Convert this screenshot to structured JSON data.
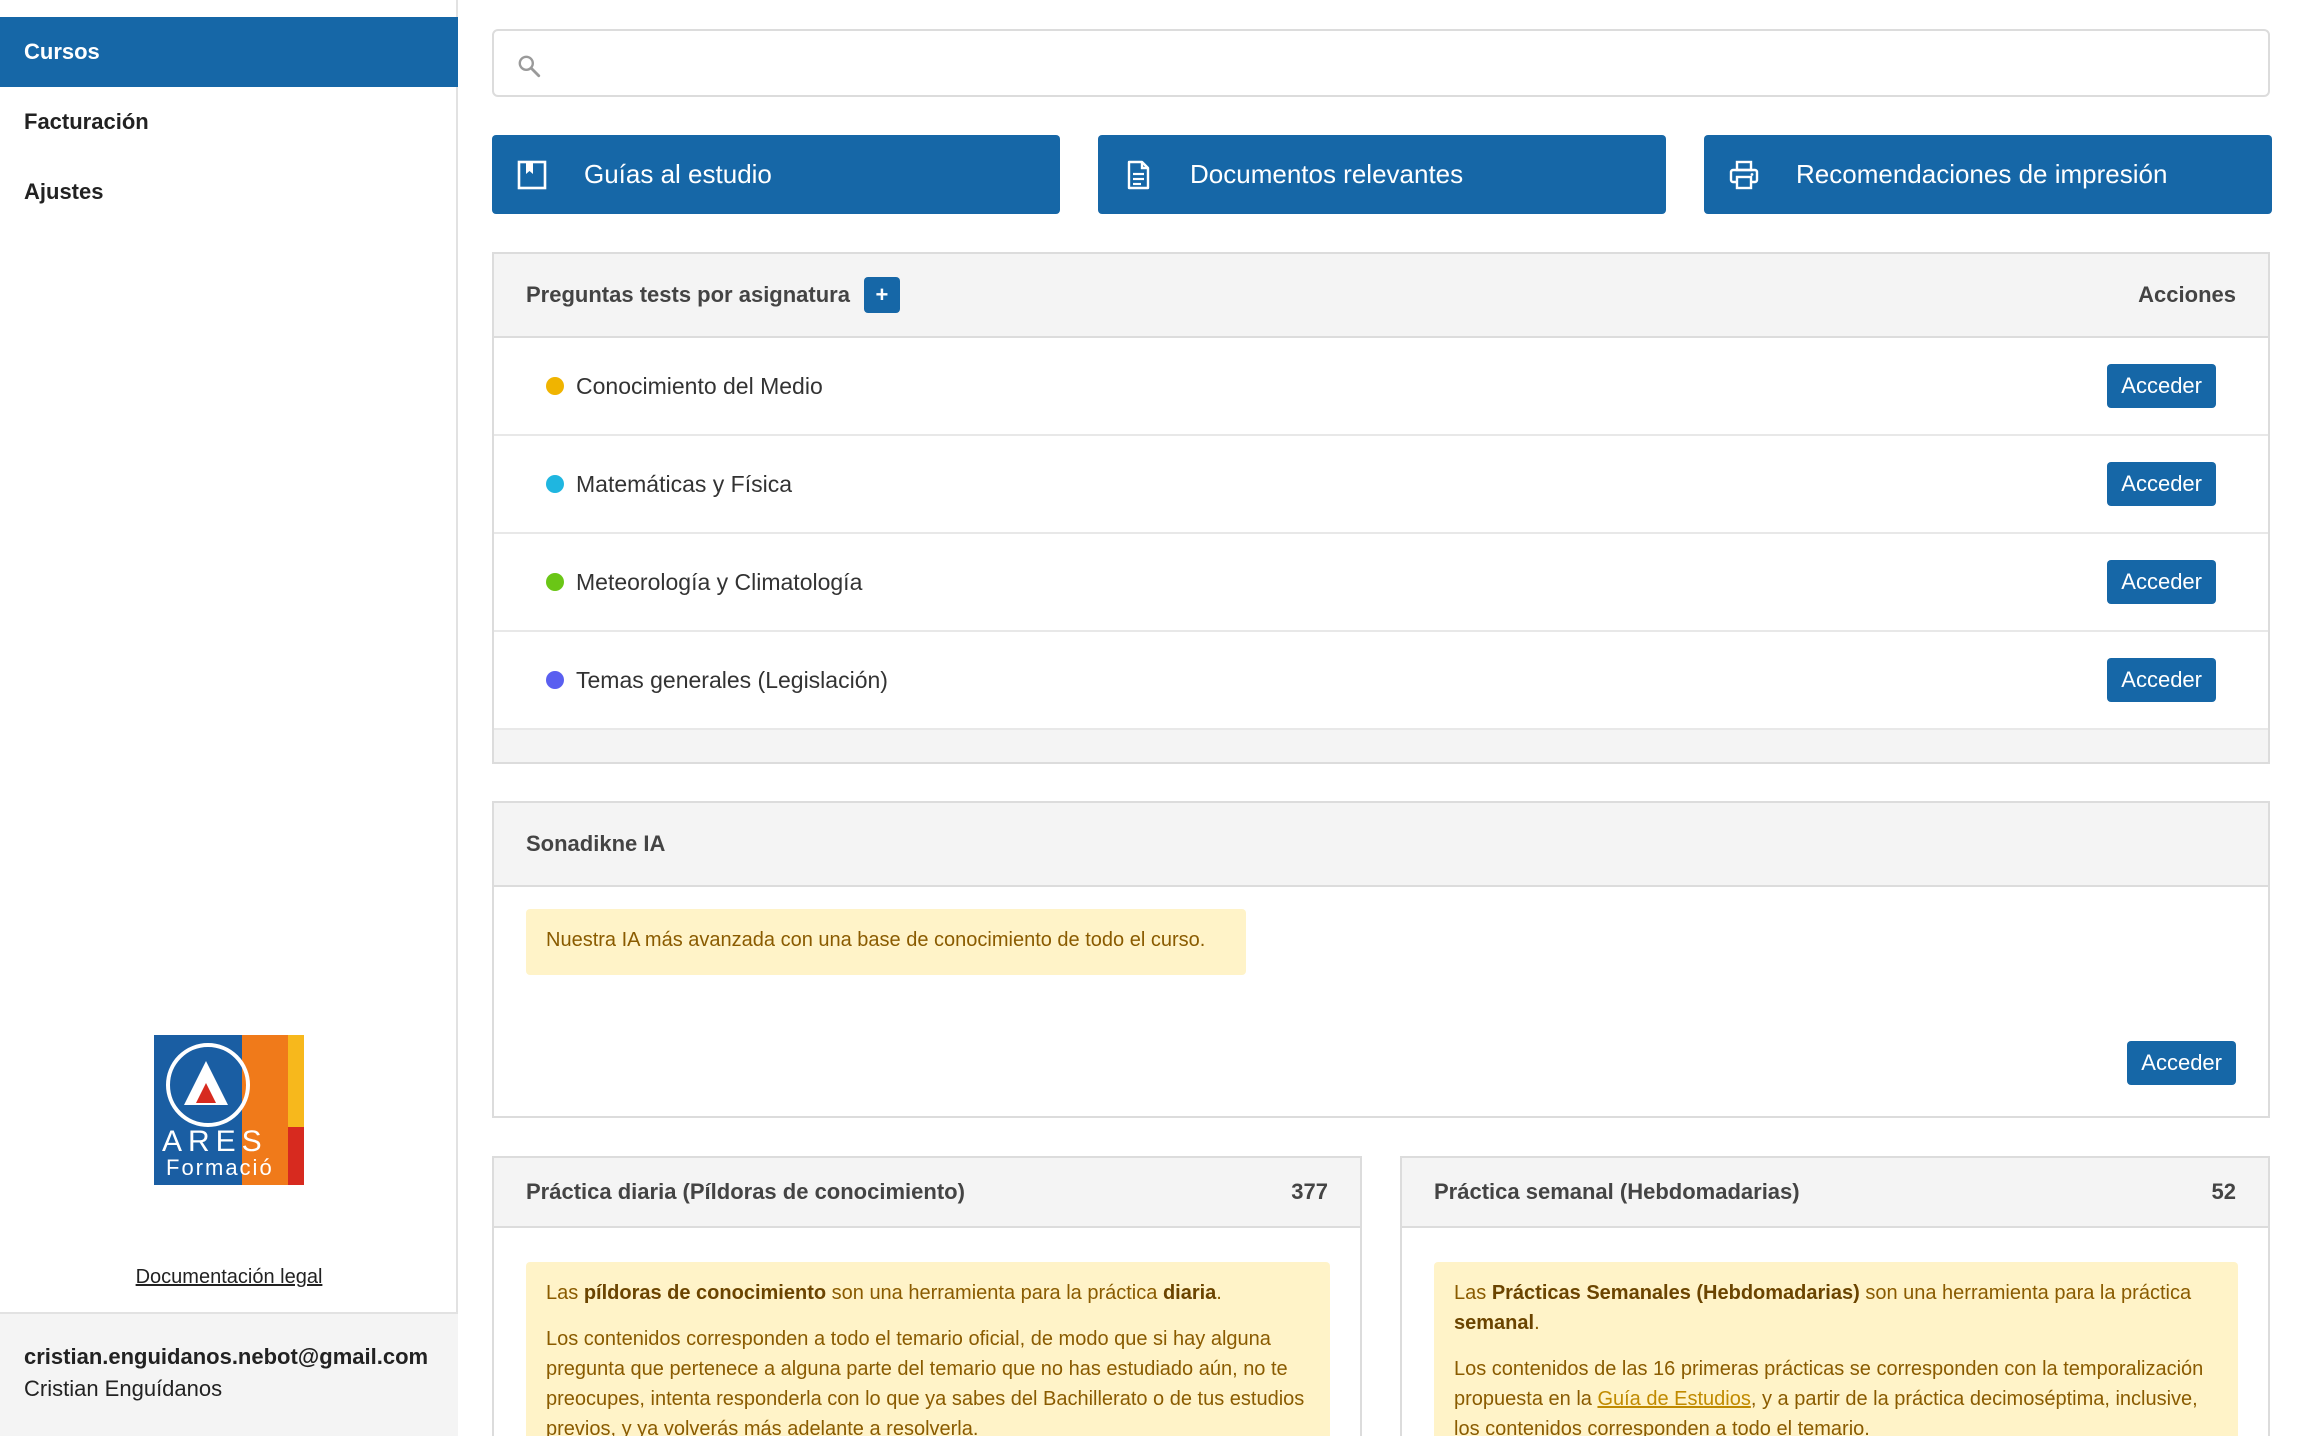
{
  "sidebar": {
    "items": [
      {
        "label": "Cursos",
        "active": true
      },
      {
        "label": "Facturación",
        "active": false
      },
      {
        "label": "Ajustes",
        "active": false
      }
    ],
    "logo": {
      "word": "ARES",
      "sub": "Formació"
    },
    "legal_link": "Documentación legal",
    "user": {
      "email": "cristian.enguidanos.nebot@gmail.com",
      "name": "Cristian Enguídanos"
    }
  },
  "search": {
    "placeholder": "",
    "value": ""
  },
  "quick_buttons": [
    {
      "label": "Guías al estudio",
      "icon": "book-icon"
    },
    {
      "label": "Documentos relevantes",
      "icon": "document-icon"
    },
    {
      "label": "Recomendaciones de impresión",
      "icon": "printer-icon"
    }
  ],
  "tests_card": {
    "title": "Preguntas tests por asignatura",
    "add_label": "+",
    "actions_label": "Acciones",
    "subjects": [
      {
        "name": "Conocimiento del Medio",
        "color": "#f0b400",
        "action": "Acceder"
      },
      {
        "name": "Matemáticas y Física",
        "color": "#1fb6e0",
        "action": "Acceder"
      },
      {
        "name": "Meteorología y Climatología",
        "color": "#6ac616",
        "action": "Acceder"
      },
      {
        "name": "Temas generales (Legislación)",
        "color": "#5a5ff0",
        "action": "Acceder"
      }
    ]
  },
  "ia_card": {
    "title": "Sonadikne IA",
    "info": "Nuestra IA más avanzada con una base de conocimiento de todo el curso.",
    "action": "Acceder"
  },
  "daily_card": {
    "title": "Práctica diaria (Píldoras de conocimiento)",
    "count": "377",
    "p1_a": "Las ",
    "p1_b": "píldoras de conocimiento",
    "p1_c": " son una herramienta para la práctica ",
    "p1_d": "diaria",
    "p1_e": ".",
    "p2": "Los contenidos corresponden a todo el temario oficial, de modo que si hay alguna pregunta que pertenece a alguna parte del temario que no has estudiado aún, no te preocupes, intenta responderla con lo que ya sabes del Bachillerato o de tus estudios previos, y ya volverás más adelante a resolverla."
  },
  "weekly_card": {
    "title": "Práctica semanal (Hebdomadarias)",
    "count": "52",
    "p1_a": "Las ",
    "p1_b": "Prácticas Semanales (Hebdomadarias)",
    "p1_c": " son una herramienta para la práctica ",
    "p1_d": "semanal",
    "p1_e": ".",
    "p2_a": "Los contenidos de las 16 primeras prácticas se corresponden con la temporalización propuesta en la ",
    "p2_link": "Guía de Estudios",
    "p2_b": ", y a partir de la práctica decimoséptima, inclusive, los contenidos corresponden a todo el temario."
  }
}
